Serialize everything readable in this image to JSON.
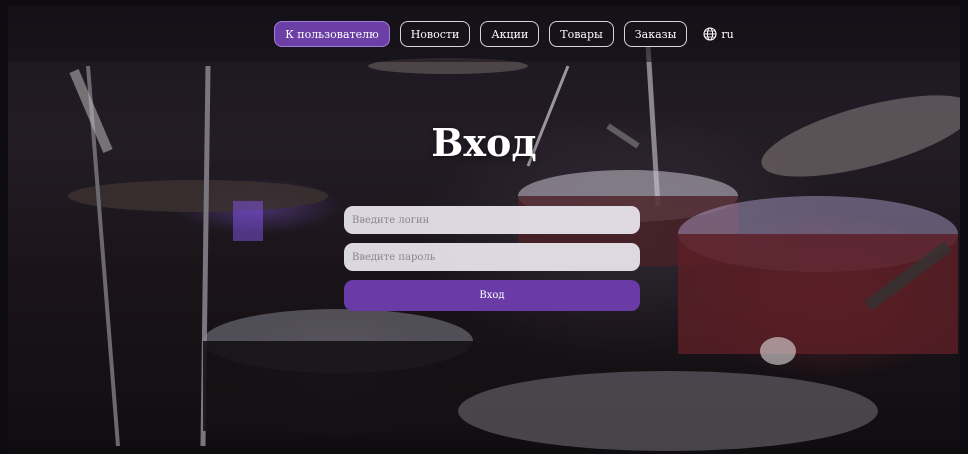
{
  "nav": {
    "items": [
      {
        "label": "К пользователю",
        "active": true
      },
      {
        "label": "Новости",
        "active": false
      },
      {
        "label": "Акции",
        "active": false
      },
      {
        "label": "Товары",
        "active": false
      },
      {
        "label": "Заказы",
        "active": false
      }
    ],
    "language": "ru"
  },
  "login": {
    "title": "Вход",
    "login_placeholder": "Введите логин",
    "password_placeholder": "Введите пароль",
    "submit_label": "Вход"
  },
  "colors": {
    "accent": "#6b3fa6",
    "background": "#1a1419"
  },
  "icons": {
    "language": "globe-icon"
  }
}
